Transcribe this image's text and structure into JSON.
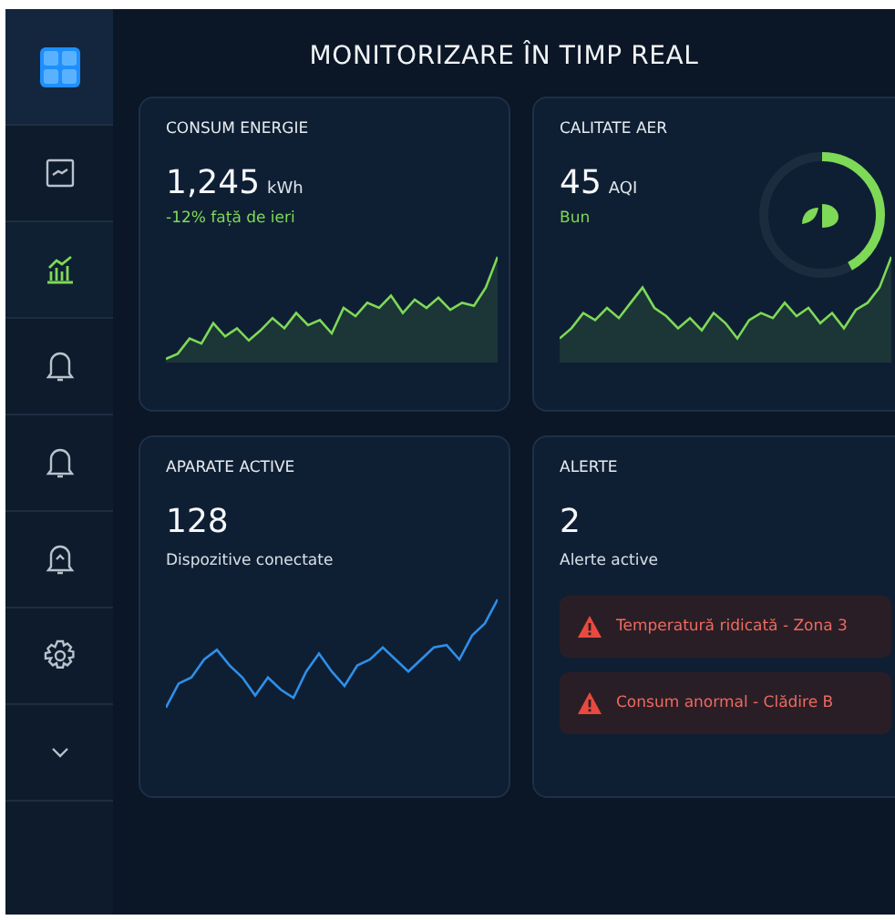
{
  "sidebar": {
    "items": [
      {
        "selected": false
      },
      {
        "selected": true
      },
      {
        "selected": false
      },
      {
        "selected": false
      },
      {
        "selected": false
      },
      {
        "selected": false
      },
      {
        "selected": false
      }
    ]
  },
  "title": "MONITORIZARE ÎN TIMP REAL",
  "cards": [
    {
      "kind": "energy",
      "title": "CONSUM ENERGIE",
      "value": "1,245",
      "unit": "kWh",
      "note": "-12% față de ieri",
      "color": "#7ed957"
    },
    {
      "kind": "air",
      "title": "CALITATE AER",
      "value": "45",
      "unit": "AQI",
      "note": "Bun",
      "color": "#7ed957"
    },
    {
      "kind": "devices",
      "title": "APARATE ACTIVE",
      "value": "128",
      "note": "Dispozitive conectate",
      "color": "#2f8fe8"
    },
    {
      "kind": "alerts",
      "title": "ALERTE",
      "value": "2",
      "note": "Alerte active",
      "alerts": [
        {
          "text": "Temperatură ridicată - Zona 3"
        },
        {
          "text": "Consum anormal - Clădire B"
        }
      ]
    }
  ]
}
